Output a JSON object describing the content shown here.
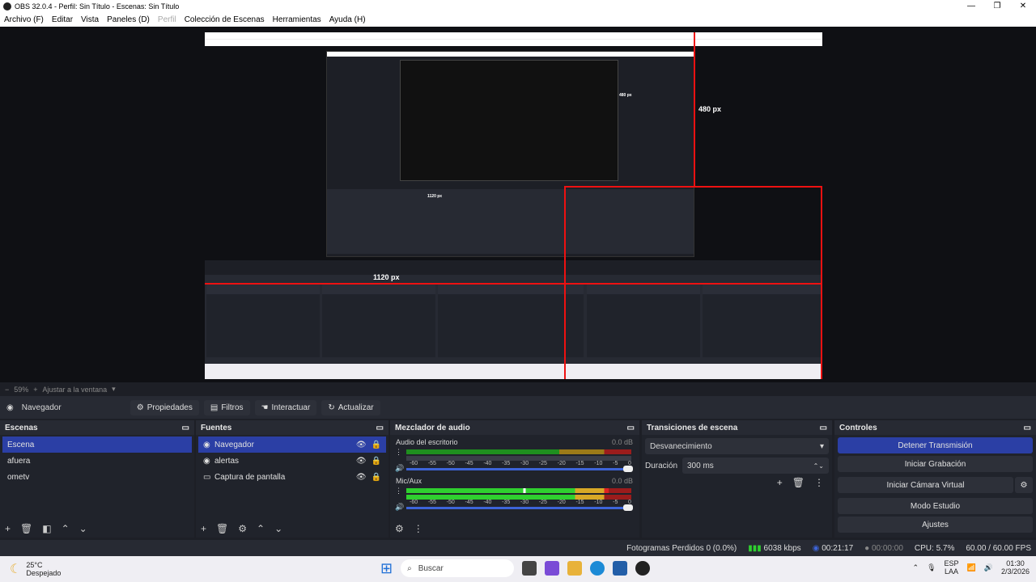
{
  "window": {
    "title": "OBS 32.0.4 - Perfil: Sin Título - Escenas: Sin Título"
  },
  "menu": [
    "Archivo (F)",
    "Editar",
    "Vista",
    "Paneles (D)",
    "Perfil",
    "Colección de Escenas",
    "Herramientas",
    "Ayuda (H)"
  ],
  "preview": {
    "label_w": "1120 px",
    "label_h": "480 px",
    "label_small": "480 px",
    "label_small_w": "1120 px"
  },
  "zoom": {
    "value": "59%",
    "fit": "Ajustar a la ventana"
  },
  "source_toolbar": {
    "name": "Navegador",
    "props": "Propiedades",
    "filters": "Filtros",
    "interact": "Interactuar",
    "refresh": "Actualizar"
  },
  "scenes": {
    "title": "Escenas",
    "items": [
      "Escena",
      "afuera",
      "ometv"
    ]
  },
  "sources": {
    "title": "Fuentes",
    "items": [
      "Navegador",
      "alertas",
      "Captura de pantalla"
    ]
  },
  "mixer": {
    "title": "Mezclador de audio",
    "tracks": [
      {
        "name": "Audio del escritorio",
        "db": "0.0 dB"
      },
      {
        "name": "Mic/Aux",
        "db": "0.0 dB"
      }
    ],
    "ticks": [
      "-60",
      "-55",
      "-50",
      "-45",
      "-40",
      "-35",
      "-30",
      "-25",
      "-20",
      "-15",
      "-10",
      "-5",
      "0"
    ]
  },
  "transitions": {
    "title": "Transiciones de escena",
    "type": "Desvanecimiento",
    "dur_label": "Duración",
    "dur": "300 ms"
  },
  "controls": {
    "title": "Controles",
    "buttons": [
      "Detener Transmisión",
      "Iniciar Grabación",
      "Iniciar Cámara Virtual",
      "Modo Estudio",
      "Ajustes"
    ]
  },
  "status": {
    "frames": "Fotogramas Perdidos 0 (0.0%)",
    "kbps": "6038 kbps",
    "stream": "00:21:17",
    "rec": "00:00:00",
    "cpu": "CPU: 5.7%",
    "fps": "60.00 / 60.00 FPS"
  },
  "taskbar": {
    "temp": "25°C",
    "weather": "Despejado",
    "search": "Buscar",
    "lang1": "ESP",
    "lang2": "LAA",
    "time": "01:30",
    "date": "2/3/2026"
  }
}
